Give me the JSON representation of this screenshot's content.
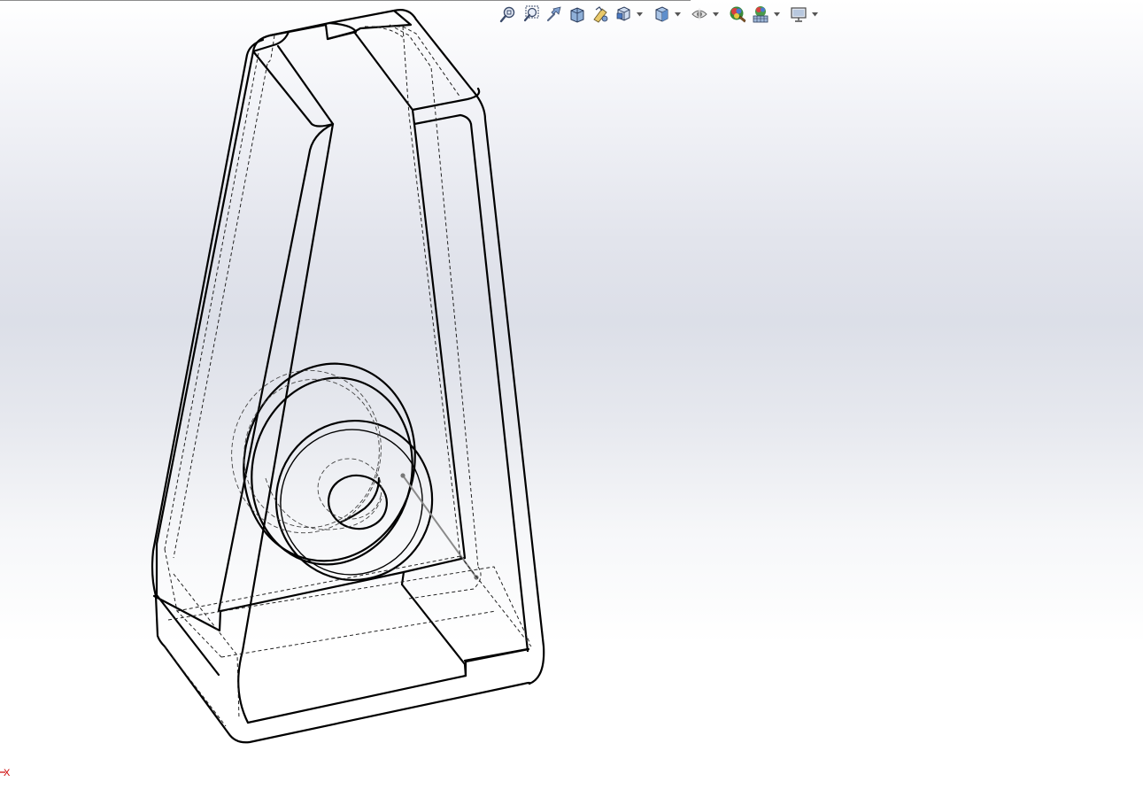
{
  "app": {
    "view_mode": "hidden-lines-visible",
    "triad_axis_label": "X",
    "colors": {
      "background_top": "#ffffff",
      "background_band": "#dcdfe8",
      "edge": "#000000",
      "sketch_line": "#8a8a8a",
      "triad_x": "#cc0000"
    }
  },
  "toolbar": {
    "items": [
      {
        "name": "zoom-to-fit",
        "icon": "zoom-to-fit-icon",
        "has_dropdown": false
      },
      {
        "name": "zoom-to-area",
        "icon": "zoom-to-area-icon",
        "has_dropdown": false
      },
      {
        "name": "previous-view",
        "icon": "previous-view-icon",
        "has_dropdown": false
      },
      {
        "name": "section-view",
        "icon": "section-view-icon",
        "has_dropdown": false
      },
      {
        "name": "dynamic-annotation-views",
        "icon": "dynamic-annotation-icon",
        "has_dropdown": false
      },
      {
        "name": "view-orientation",
        "icon": "view-orientation-icon",
        "has_dropdown": true
      },
      {
        "name": "display-style",
        "icon": "display-style-icon",
        "has_dropdown": true
      },
      {
        "name": "hide-show-items",
        "icon": "hide-show-eye-icon",
        "has_dropdown": true
      },
      {
        "name": "edit-appearance",
        "icon": "edit-appearance-icon",
        "has_dropdown": false
      },
      {
        "name": "apply-scene",
        "icon": "apply-scene-icon",
        "has_dropdown": true
      },
      {
        "name": "view-settings",
        "icon": "monitor-icon",
        "has_dropdown": true
      }
    ]
  }
}
